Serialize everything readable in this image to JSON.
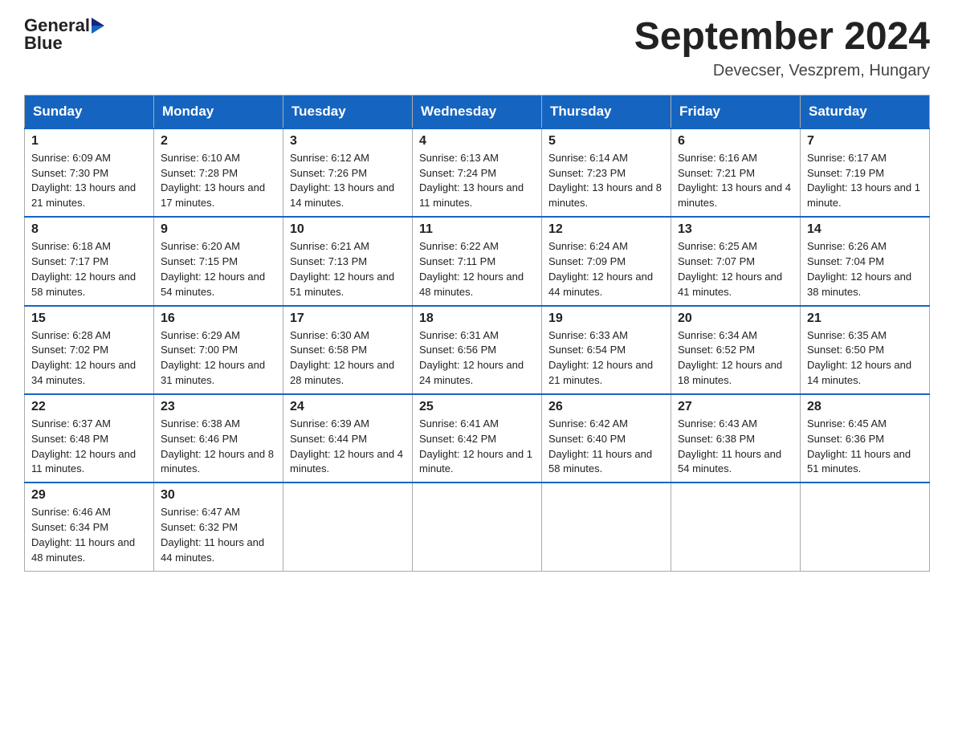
{
  "header": {
    "logo_text_general": "General",
    "logo_text_blue": "Blue",
    "month_title": "September 2024",
    "location": "Devecser, Veszprem, Hungary"
  },
  "calendar": {
    "days_of_week": [
      "Sunday",
      "Monday",
      "Tuesday",
      "Wednesday",
      "Thursday",
      "Friday",
      "Saturday"
    ],
    "weeks": [
      [
        {
          "day": "1",
          "sunrise": "Sunrise: 6:09 AM",
          "sunset": "Sunset: 7:30 PM",
          "daylight": "Daylight: 13 hours and 21 minutes."
        },
        {
          "day": "2",
          "sunrise": "Sunrise: 6:10 AM",
          "sunset": "Sunset: 7:28 PM",
          "daylight": "Daylight: 13 hours and 17 minutes."
        },
        {
          "day": "3",
          "sunrise": "Sunrise: 6:12 AM",
          "sunset": "Sunset: 7:26 PM",
          "daylight": "Daylight: 13 hours and 14 minutes."
        },
        {
          "day": "4",
          "sunrise": "Sunrise: 6:13 AM",
          "sunset": "Sunset: 7:24 PM",
          "daylight": "Daylight: 13 hours and 11 minutes."
        },
        {
          "day": "5",
          "sunrise": "Sunrise: 6:14 AM",
          "sunset": "Sunset: 7:23 PM",
          "daylight": "Daylight: 13 hours and 8 minutes."
        },
        {
          "day": "6",
          "sunrise": "Sunrise: 6:16 AM",
          "sunset": "Sunset: 7:21 PM",
          "daylight": "Daylight: 13 hours and 4 minutes."
        },
        {
          "day": "7",
          "sunrise": "Sunrise: 6:17 AM",
          "sunset": "Sunset: 7:19 PM",
          "daylight": "Daylight: 13 hours and 1 minute."
        }
      ],
      [
        {
          "day": "8",
          "sunrise": "Sunrise: 6:18 AM",
          "sunset": "Sunset: 7:17 PM",
          "daylight": "Daylight: 12 hours and 58 minutes."
        },
        {
          "day": "9",
          "sunrise": "Sunrise: 6:20 AM",
          "sunset": "Sunset: 7:15 PM",
          "daylight": "Daylight: 12 hours and 54 minutes."
        },
        {
          "day": "10",
          "sunrise": "Sunrise: 6:21 AM",
          "sunset": "Sunset: 7:13 PM",
          "daylight": "Daylight: 12 hours and 51 minutes."
        },
        {
          "day": "11",
          "sunrise": "Sunrise: 6:22 AM",
          "sunset": "Sunset: 7:11 PM",
          "daylight": "Daylight: 12 hours and 48 minutes."
        },
        {
          "day": "12",
          "sunrise": "Sunrise: 6:24 AM",
          "sunset": "Sunset: 7:09 PM",
          "daylight": "Daylight: 12 hours and 44 minutes."
        },
        {
          "day": "13",
          "sunrise": "Sunrise: 6:25 AM",
          "sunset": "Sunset: 7:07 PM",
          "daylight": "Daylight: 12 hours and 41 minutes."
        },
        {
          "day": "14",
          "sunrise": "Sunrise: 6:26 AM",
          "sunset": "Sunset: 7:04 PM",
          "daylight": "Daylight: 12 hours and 38 minutes."
        }
      ],
      [
        {
          "day": "15",
          "sunrise": "Sunrise: 6:28 AM",
          "sunset": "Sunset: 7:02 PM",
          "daylight": "Daylight: 12 hours and 34 minutes."
        },
        {
          "day": "16",
          "sunrise": "Sunrise: 6:29 AM",
          "sunset": "Sunset: 7:00 PM",
          "daylight": "Daylight: 12 hours and 31 minutes."
        },
        {
          "day": "17",
          "sunrise": "Sunrise: 6:30 AM",
          "sunset": "Sunset: 6:58 PM",
          "daylight": "Daylight: 12 hours and 28 minutes."
        },
        {
          "day": "18",
          "sunrise": "Sunrise: 6:31 AM",
          "sunset": "Sunset: 6:56 PM",
          "daylight": "Daylight: 12 hours and 24 minutes."
        },
        {
          "day": "19",
          "sunrise": "Sunrise: 6:33 AM",
          "sunset": "Sunset: 6:54 PM",
          "daylight": "Daylight: 12 hours and 21 minutes."
        },
        {
          "day": "20",
          "sunrise": "Sunrise: 6:34 AM",
          "sunset": "Sunset: 6:52 PM",
          "daylight": "Daylight: 12 hours and 18 minutes."
        },
        {
          "day": "21",
          "sunrise": "Sunrise: 6:35 AM",
          "sunset": "Sunset: 6:50 PM",
          "daylight": "Daylight: 12 hours and 14 minutes."
        }
      ],
      [
        {
          "day": "22",
          "sunrise": "Sunrise: 6:37 AM",
          "sunset": "Sunset: 6:48 PM",
          "daylight": "Daylight: 12 hours and 11 minutes."
        },
        {
          "day": "23",
          "sunrise": "Sunrise: 6:38 AM",
          "sunset": "Sunset: 6:46 PM",
          "daylight": "Daylight: 12 hours and 8 minutes."
        },
        {
          "day": "24",
          "sunrise": "Sunrise: 6:39 AM",
          "sunset": "Sunset: 6:44 PM",
          "daylight": "Daylight: 12 hours and 4 minutes."
        },
        {
          "day": "25",
          "sunrise": "Sunrise: 6:41 AM",
          "sunset": "Sunset: 6:42 PM",
          "daylight": "Daylight: 12 hours and 1 minute."
        },
        {
          "day": "26",
          "sunrise": "Sunrise: 6:42 AM",
          "sunset": "Sunset: 6:40 PM",
          "daylight": "Daylight: 11 hours and 58 minutes."
        },
        {
          "day": "27",
          "sunrise": "Sunrise: 6:43 AM",
          "sunset": "Sunset: 6:38 PM",
          "daylight": "Daylight: 11 hours and 54 minutes."
        },
        {
          "day": "28",
          "sunrise": "Sunrise: 6:45 AM",
          "sunset": "Sunset: 6:36 PM",
          "daylight": "Daylight: 11 hours and 51 minutes."
        }
      ],
      [
        {
          "day": "29",
          "sunrise": "Sunrise: 6:46 AM",
          "sunset": "Sunset: 6:34 PM",
          "daylight": "Daylight: 11 hours and 48 minutes."
        },
        {
          "day": "30",
          "sunrise": "Sunrise: 6:47 AM",
          "sunset": "Sunset: 6:32 PM",
          "daylight": "Daylight: 11 hours and 44 minutes."
        },
        null,
        null,
        null,
        null,
        null
      ]
    ]
  }
}
